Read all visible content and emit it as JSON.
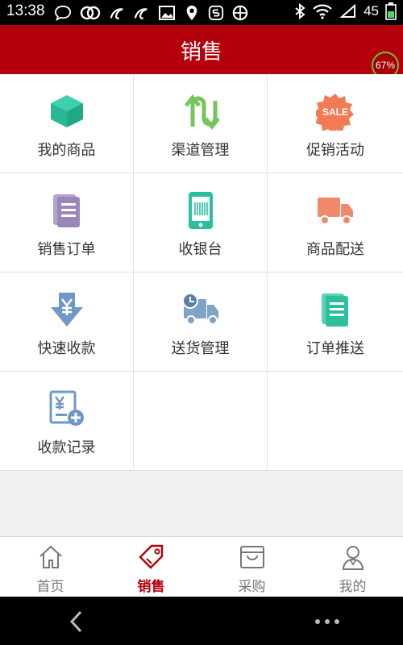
{
  "status": {
    "time": "13:38",
    "battery": "45"
  },
  "header": {
    "title": "销售",
    "badge": "67%"
  },
  "grid": [
    {
      "label": "我的商品",
      "icon": "cube-icon"
    },
    {
      "label": "渠道管理",
      "icon": "transfer-arrows-icon"
    },
    {
      "label": "促销活动",
      "icon": "sale-badge-icon"
    },
    {
      "label": "销售订单",
      "icon": "order-document-icon"
    },
    {
      "label": "收银台",
      "icon": "phone-barcode-icon"
    },
    {
      "label": "商品配送",
      "icon": "delivery-truck-icon"
    },
    {
      "label": "快速收款",
      "icon": "yen-download-icon"
    },
    {
      "label": "送货管理",
      "icon": "truck-clock-icon"
    },
    {
      "label": "订单推送",
      "icon": "push-document-icon"
    },
    {
      "label": "收款记录",
      "icon": "receipt-add-icon"
    }
  ],
  "tabs": [
    {
      "label": "首页",
      "icon": "home-icon"
    },
    {
      "label": "销售",
      "icon": "tag-icon"
    },
    {
      "label": "采购",
      "icon": "basket-icon"
    },
    {
      "label": "我的",
      "icon": "user-icon"
    }
  ],
  "colors": {
    "brand": "#b3000c",
    "teal": "#2bbf9e",
    "green": "#6fc25a",
    "purple": "#9a86bb",
    "orange": "#f08a6b",
    "blue": "#7fa3c7"
  }
}
